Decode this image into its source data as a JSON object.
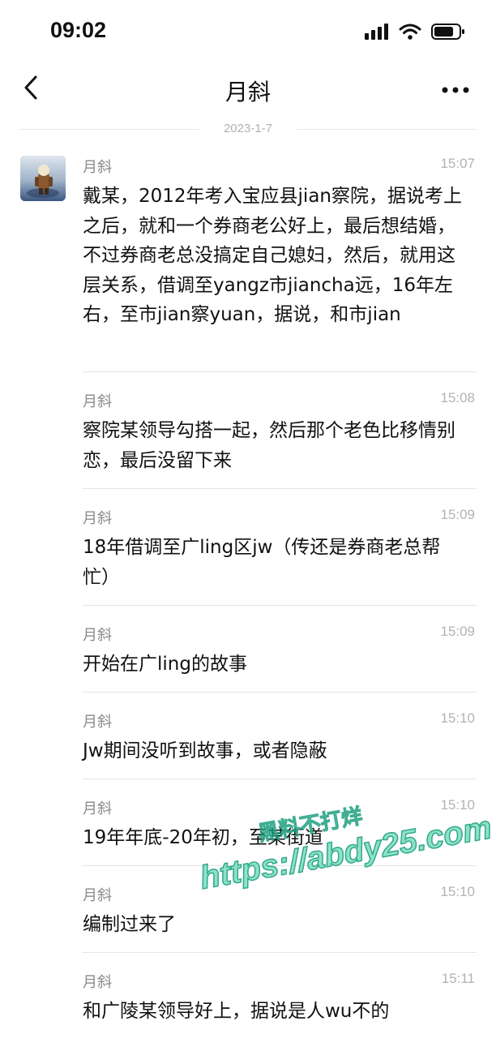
{
  "status_bar": {
    "time": "09:02",
    "icons": [
      "signal-icon",
      "wifi-icon",
      "battery-icon"
    ]
  },
  "nav": {
    "title": "月斜",
    "back_icon": "chevron-left-icon",
    "more_icon": "more-dots-icon"
  },
  "date_separator": "2023-1-7",
  "messages": [
    {
      "sender": "月斜",
      "time": "15:07",
      "text": "戴某，2012年考入宝应县jian察院，据说考上之后，就和一个券商老公好上，最后想结婚，不过券商老总没搞定自己媳妇，然后，就用这层关系，借调至yangz市jiancha远，16年左右，至市jian察yuan，据说，和市jian"
    },
    {
      "sender": "月斜",
      "time": "15:08",
      "text": "察院某领导勾搭一起，然后那个老色比移情别恋，最后没留下来"
    },
    {
      "sender": "月斜",
      "time": "15:09",
      "text": "18年借调至广ling区jw（传还是券商老总帮忙）"
    },
    {
      "sender": "月斜",
      "time": "15:09",
      "text": "开始在广ling的故事"
    },
    {
      "sender": "月斜",
      "time": "15:10",
      "text": "Jw期间没听到故事，或者隐蔽"
    },
    {
      "sender": "月斜",
      "time": "15:10",
      "text": "19年年底-20年初，至某街道"
    },
    {
      "sender": "月斜",
      "time": "15:10",
      "text": "编制过来了"
    },
    {
      "sender": "月斜",
      "time": "15:11",
      "text": "和广陵某领导好上，据说是人wu不的"
    }
  ],
  "watermark": {
    "line1": "黑料不打烊",
    "line2": "https://abdy25.com"
  },
  "colors": {
    "background": "#ffffff",
    "text": "#111111",
    "meta_text": "#8a8a8a",
    "time_text": "#b3b3b3",
    "divider": "#e5e5e5",
    "watermark": "#7fe0c0"
  }
}
